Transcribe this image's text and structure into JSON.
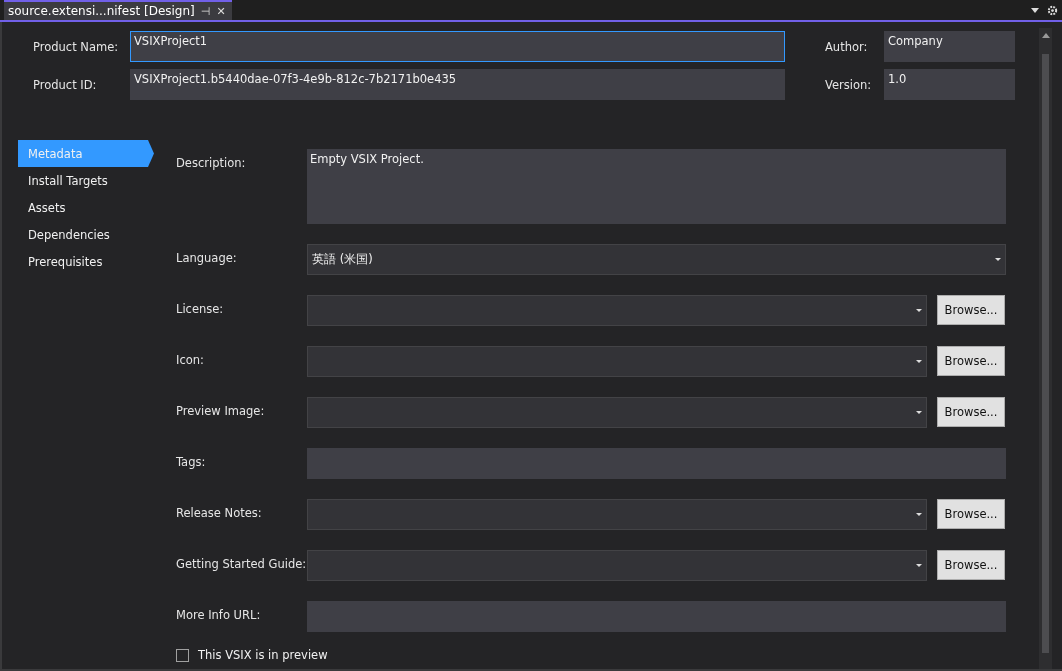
{
  "tab": {
    "title": "source.extensi...nifest [Design]",
    "pin": "⊣",
    "close": "✕"
  },
  "header": [
    {
      "label": "Product Name:",
      "value": "VSIXProject1",
      "focused": true
    },
    {
      "label": "Product ID:",
      "value": "VSIXProject1.b5440dae-07f3-4e9b-812c-7b2171b0e435",
      "focused": false
    }
  ],
  "header_side": [
    {
      "label": "Author:",
      "value": "Company"
    },
    {
      "label": "Version:",
      "value": "1.0"
    }
  ],
  "sidebar": {
    "items": [
      {
        "label": "Metadata",
        "selected": true
      },
      {
        "label": "Install Targets",
        "selected": false
      },
      {
        "label": "Assets",
        "selected": false
      },
      {
        "label": "Dependencies",
        "selected": false
      },
      {
        "label": "Prerequisites",
        "selected": false
      }
    ]
  },
  "fields": [
    {
      "kind": "textarea",
      "label": "Description:",
      "value": "Empty VSIX Project."
    },
    {
      "kind": "combo",
      "label": "Language:",
      "value": "英語 (米国)"
    },
    {
      "kind": "combo-browse",
      "label": "License:",
      "button": "Browse..."
    },
    {
      "kind": "combo-browse",
      "label": "Icon:",
      "button": "Browse..."
    },
    {
      "kind": "combo-browse",
      "label": "Preview Image:",
      "button": "Browse..."
    },
    {
      "kind": "text",
      "label": "Tags:"
    },
    {
      "kind": "combo-browse",
      "label": "Release Notes:",
      "button": "Browse..."
    },
    {
      "kind": "combo-browse",
      "label": "Getting Started Guide:",
      "button": "Browse..."
    },
    {
      "kind": "text",
      "label": "More Info URL:"
    }
  ],
  "preview_checkbox": {
    "label": "This VSIX is in preview",
    "checked": false
  }
}
